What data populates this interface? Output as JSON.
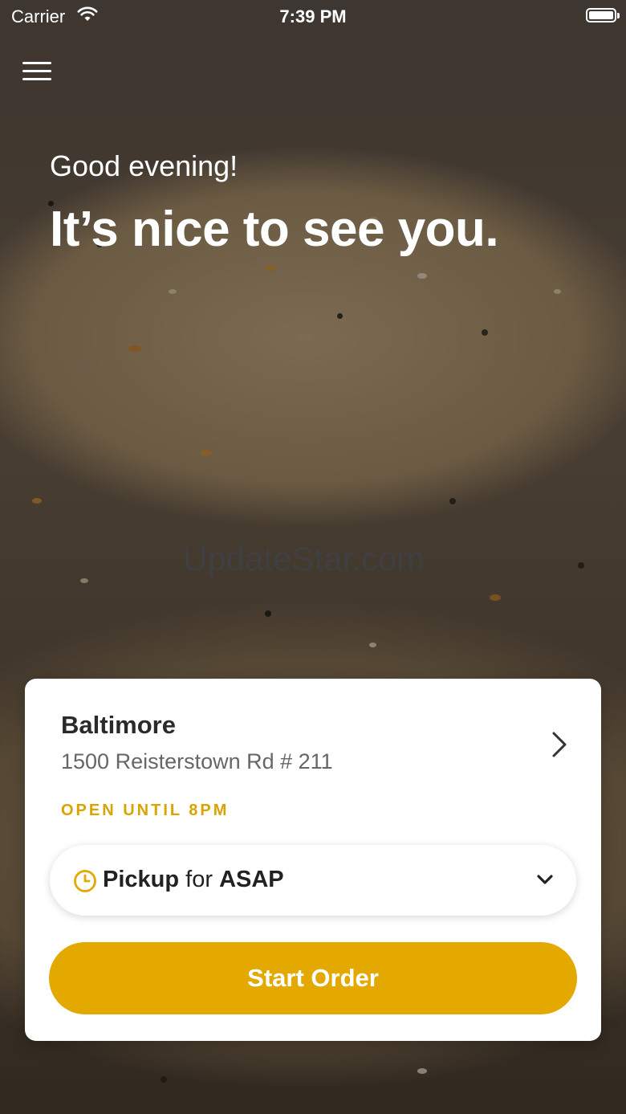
{
  "status_bar": {
    "carrier": "Carrier",
    "time": "7:39 PM"
  },
  "hero": {
    "greeting": "Good evening!",
    "headline": "It’s nice to see you.",
    "watermark": "UpdateStar.com"
  },
  "location": {
    "name": "Baltimore",
    "address": "1500 Reisterstown Rd # 211",
    "hours": "OPEN UNTIL 8PM"
  },
  "order_mode": {
    "mode": "Pickup",
    "connector": "for",
    "time": "ASAP"
  },
  "actions": {
    "start_order": "Start Order"
  },
  "colors": {
    "accent": "#e3a900",
    "hours_text": "#d9a400",
    "card_bg": "#ffffff"
  },
  "icons": [
    "wifi-icon",
    "battery-icon",
    "menu-icon",
    "chevron-right-icon",
    "clock-icon",
    "chevron-down-icon"
  ]
}
